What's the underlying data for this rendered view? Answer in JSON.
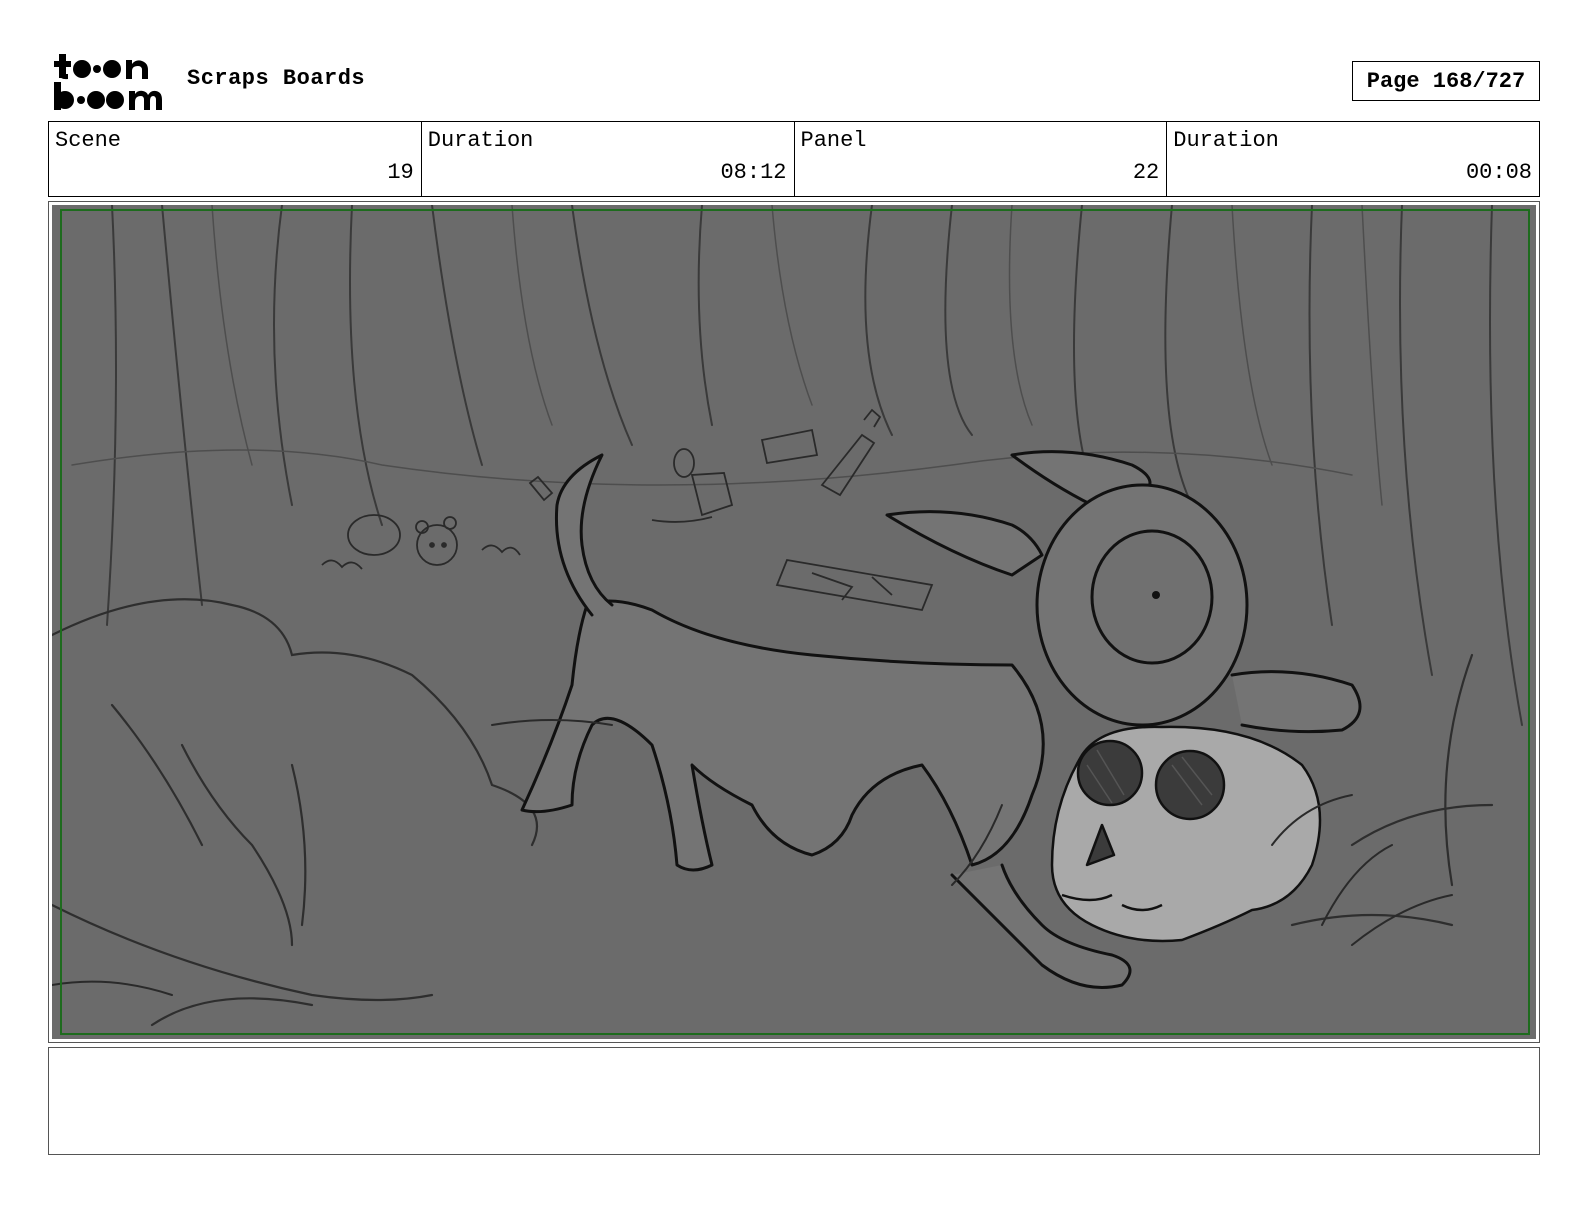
{
  "header": {
    "logo": {
      "line1": "toon",
      "line2": "boom"
    },
    "title": "Scraps Boards",
    "page": "Page 168/727"
  },
  "info": [
    {
      "label": "Scene",
      "value": "19"
    },
    {
      "label": "Duration",
      "value": "08:12"
    },
    {
      "label": "Panel",
      "value": "22"
    },
    {
      "label": "Duration",
      "value": "00:08"
    }
  ],
  "panel": {
    "background": "#6b6b6b",
    "safe_frame_color": "#1d6b1d"
  },
  "notes": {
    "text": ""
  }
}
